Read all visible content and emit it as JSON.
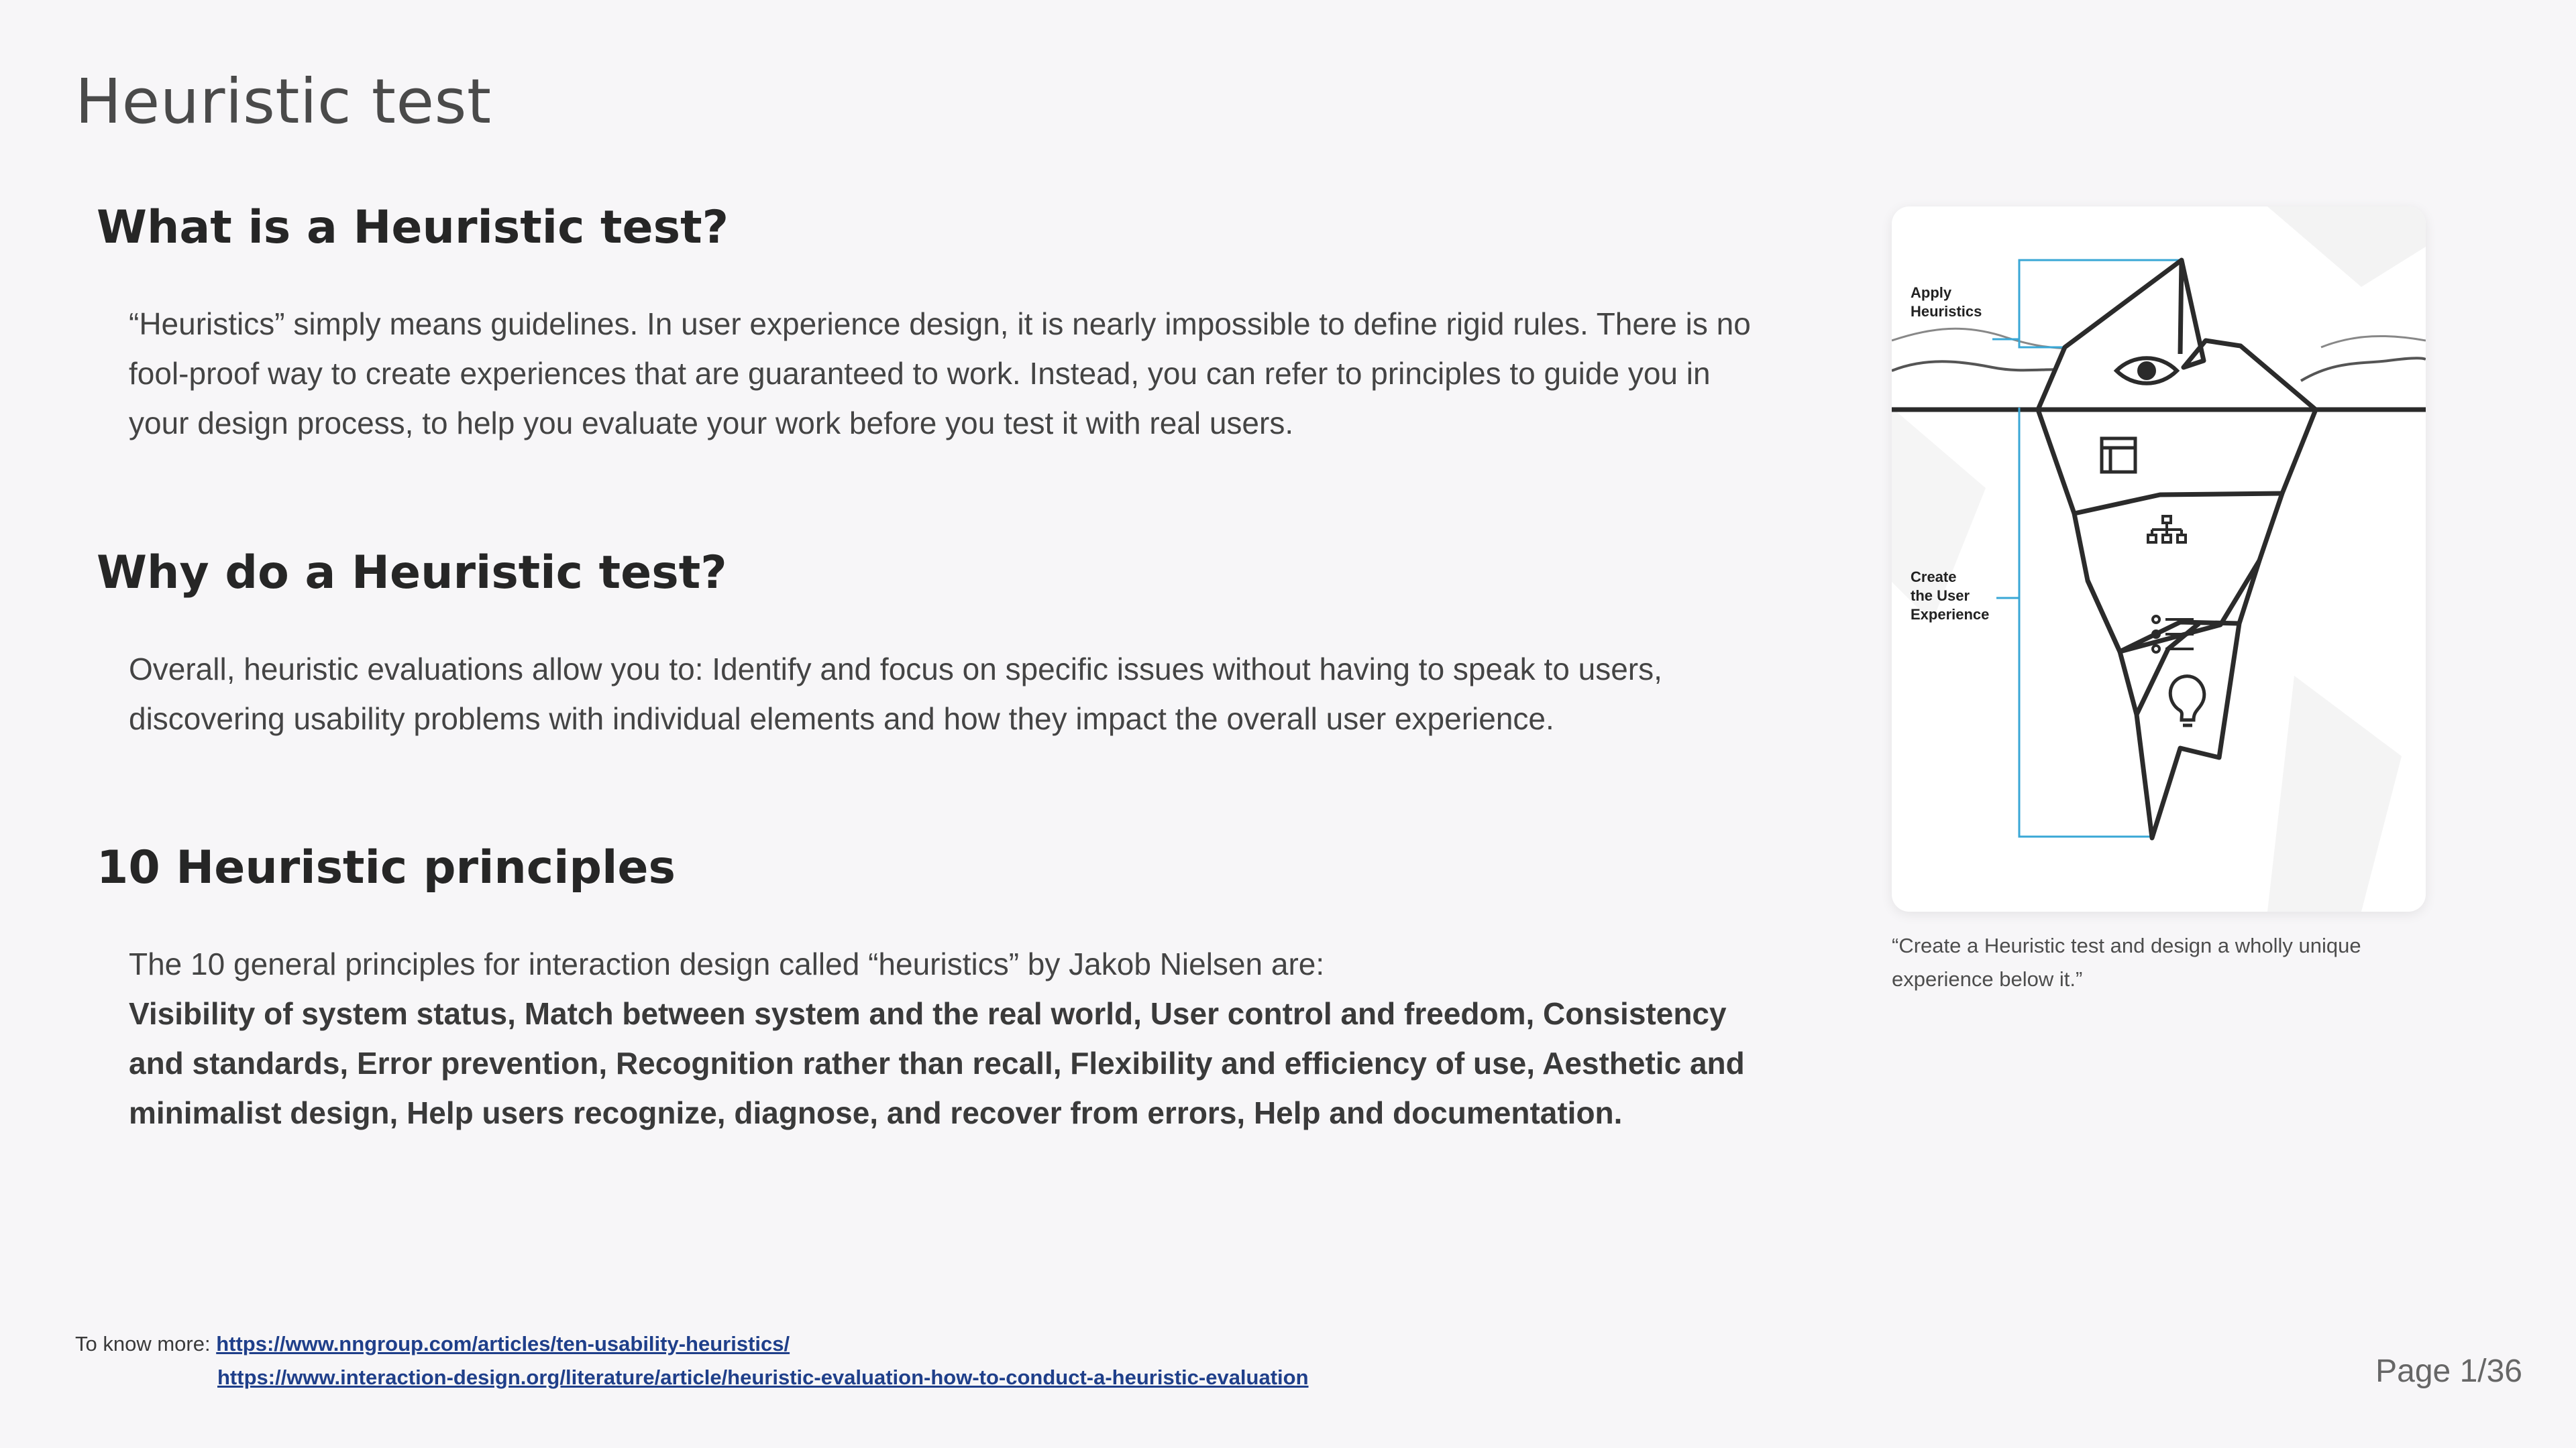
{
  "page": {
    "title": "Heuristic test",
    "page_number": "Page 1/36"
  },
  "sections": [
    {
      "heading": "What is a Heuristic test?",
      "body": "“Heuristics” simply means guidelines. In user experience design, it is nearly impossible to define rigid rules. There is no fool-proof way to create experiences that are guaranteed to work. Instead, you can refer to principles to guide you in your design process, to help you evaluate your work before you test it with real users."
    },
    {
      "heading": "Why do a Heuristic test?",
      "body": "Overall, heuristic evaluations allow you to: Identify and focus on specific issues without having to speak to users, discovering usability problems with individual elements and how they impact the overall user experience."
    },
    {
      "heading": "10 Heuristic principles",
      "intro": "The 10 general principles for interaction design called “heuristics” by Jakob Nielsen are:",
      "principles": "Visibility of system status, Match between system and the real world, User control and freedom, Consistency and standards, Error prevention, Recognition rather than recall, Flexibility and efficiency of use, Aesthetic and minimalist design, Help users recognize, diagnose, and recover from errors, Help and documentation."
    }
  ],
  "figure": {
    "label_top": [
      "Apply",
      "Heuristics"
    ],
    "label_bottom": [
      "Create",
      "the User",
      "Experience"
    ],
    "caption": "“Create a Heuristic test and design a wholly unique experience below it.”",
    "accent_color": "#39a7d6",
    "icons": [
      "eye-icon",
      "layout-icon",
      "sitemap-icon",
      "list-icon",
      "lightbulb-icon"
    ]
  },
  "footer": {
    "prefix": "To know more:",
    "link1": "https://www.nngroup.com/articles/ten-usability-heuristics/",
    "link2": "https://www.interaction-design.org/literature/article/heuristic-evaluation-how-to-conduct-a-heuristic-evaluation"
  }
}
